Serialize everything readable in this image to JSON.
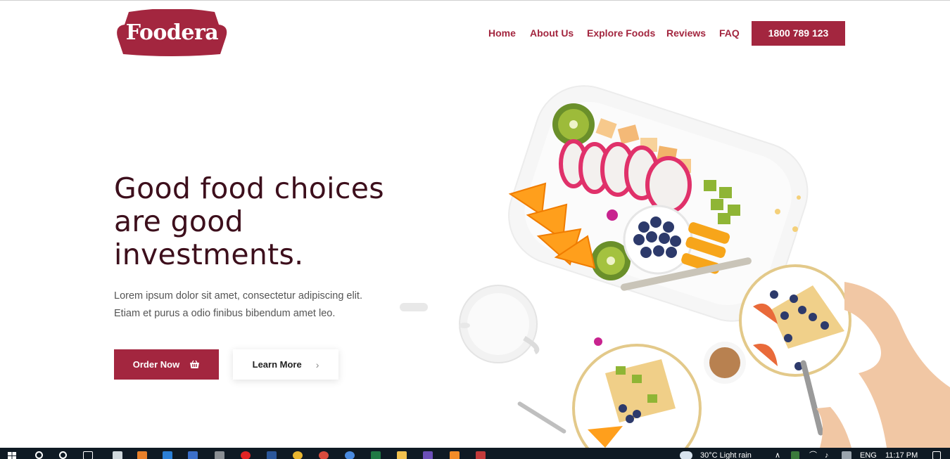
{
  "brand": {
    "logo_text": "Foodera",
    "primary_color": "#a3263f",
    "heading_color": "#3d0f1c"
  },
  "nav": {
    "items": [
      "Home",
      "About Us",
      "Explore Foods",
      "Reviews",
      "FAQ"
    ],
    "phone_label": "1800 789 123"
  },
  "hero": {
    "headline_line1": "Good food choices",
    "headline_line2": "are good",
    "headline_line3": "investments.",
    "desc_line1": "Lorem ipsum dolor sit amet, consectetur adipiscing elit.",
    "desc_line2": "Etiam et purus a odio finibus bibendum amet leo.",
    "order_label": "Order Now",
    "order_icon": "basket-icon",
    "learn_label": "Learn More",
    "learn_icon": "chevron-right-icon"
  },
  "taskbar": {
    "weather": "30°C  Light rain",
    "language": "ENG",
    "time": "11:17 PM"
  }
}
